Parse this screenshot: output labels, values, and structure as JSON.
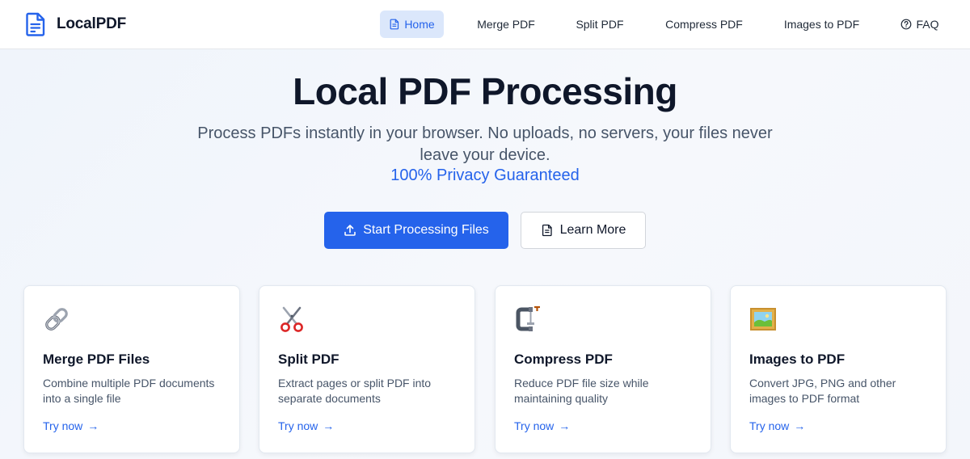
{
  "brand": {
    "name": "LocalPDF",
    "icon": "document-icon"
  },
  "nav": {
    "items": [
      {
        "label": "Home",
        "icon": "document-icon",
        "active": true
      },
      {
        "label": "Merge PDF"
      },
      {
        "label": "Split PDF"
      },
      {
        "label": "Compress PDF"
      },
      {
        "label": "Images to PDF"
      },
      {
        "label": "FAQ",
        "icon": "question-circle-icon"
      }
    ]
  },
  "hero": {
    "title": "Local PDF Processing",
    "subtitle": "Process PDFs instantly in your browser. No uploads, no servers, your files never leave your device.",
    "privacy": "100% Privacy Guaranteed",
    "primary_button": {
      "label": "Start Processing Files",
      "icon": "upload-icon"
    },
    "secondary_button": {
      "label": "Learn More",
      "icon": "document-icon"
    }
  },
  "cards": [
    {
      "icon": "link-icon",
      "title": "Merge PDF Files",
      "description": "Combine multiple PDF documents into a single file",
      "link": "Try now"
    },
    {
      "icon": "scissors-icon",
      "title": "Split PDF",
      "description": "Extract pages or split PDF into separate documents",
      "link": "Try now"
    },
    {
      "icon": "clamp-icon",
      "title": "Compress PDF",
      "description": "Reduce PDF file size while maintaining quality",
      "link": "Try now"
    },
    {
      "icon": "framed-picture-icon",
      "title": "Images to PDF",
      "description": "Convert JPG, PNG and other images to PDF format",
      "link": "Try now"
    }
  ],
  "colors": {
    "accent": "#2563eb",
    "active_nav_bg": "#dbe7fb",
    "text": "#0f172a",
    "muted": "#475569"
  }
}
